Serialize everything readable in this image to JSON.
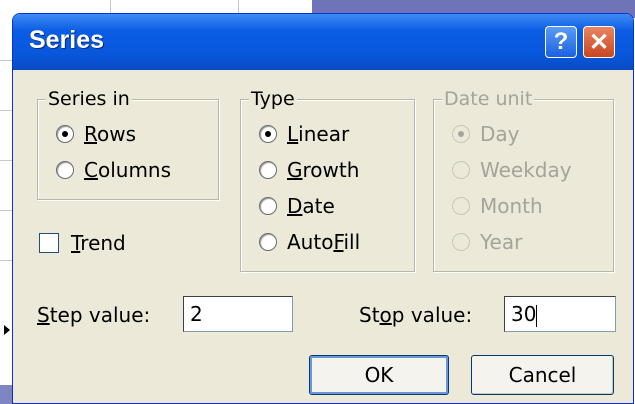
{
  "window": {
    "title": "Series"
  },
  "titlebar": {
    "help_label": "?",
    "close_label": "✕"
  },
  "series_in": {
    "legend": "Series in",
    "options": [
      {
        "pre": "",
        "key": "R",
        "post": "ows",
        "checked": true
      },
      {
        "pre": "",
        "key": "C",
        "post": "olumns",
        "checked": false
      }
    ]
  },
  "type": {
    "legend": "Type",
    "options": [
      {
        "pre": "",
        "key": "L",
        "post": "inear",
        "checked": true
      },
      {
        "pre": "",
        "key": "G",
        "post": "rowth",
        "checked": false
      },
      {
        "pre": "",
        "key": "D",
        "post": "ate",
        "checked": false
      },
      {
        "pre": "Auto",
        "key": "F",
        "post": "ill",
        "checked": false
      }
    ]
  },
  "date_unit": {
    "legend": "Date unit",
    "disabled": true,
    "options": [
      {
        "label": "Day",
        "checked": true
      },
      {
        "label": "Weekday",
        "checked": false
      },
      {
        "label": "Month",
        "checked": false
      },
      {
        "label": "Year",
        "checked": false
      }
    ]
  },
  "trend": {
    "key": "T",
    "rest": "rend",
    "checked": false
  },
  "step": {
    "key": "S",
    "rest": "tep value:",
    "value": "2"
  },
  "stop": {
    "pre": "St",
    "key": "o",
    "post": "p value:",
    "value": "30"
  },
  "buttons": {
    "ok": "OK",
    "cancel": "Cancel"
  }
}
